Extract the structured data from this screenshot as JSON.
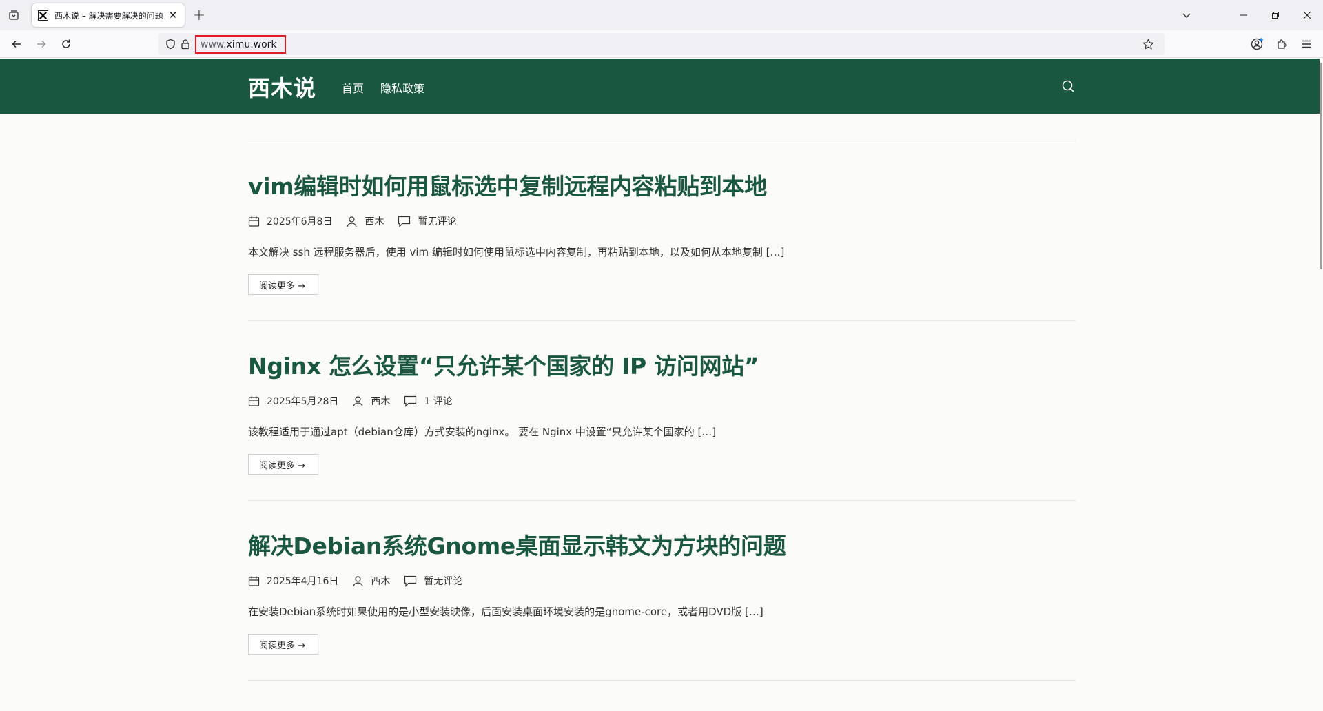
{
  "browser": {
    "tab": {
      "title": "西木说 – 解决需要解决的问题",
      "close_glyph": "✕"
    },
    "new_tab_glyph": "+",
    "url": {
      "prefix": "www.",
      "host": "ximu.work"
    }
  },
  "site": {
    "logo": "西木说",
    "nav": [
      "首页",
      "隐私政策"
    ],
    "brand_color": "#1a5741"
  },
  "posts": [
    {
      "title": "vim编辑时如何用鼠标选中复制远程内容粘贴到本地",
      "date": "2025年6月8日",
      "author": "西木",
      "comments": "暂无评论",
      "excerpt": "本文解决 ssh 远程服务器后，使用 vim 编辑时如何使用鼠标选中内容复制，再粘贴到本地，以及如何从本地复制 […]",
      "read_more": "阅读更多 →"
    },
    {
      "title": "Nginx 怎么设置“只允许某个国家的 IP 访问网站”",
      "date": "2025年5月28日",
      "author": "西木",
      "comments": "1 评论",
      "excerpt": "该教程适用于通过apt（debian仓库）方式安装的nginx。 要在 Nginx 中设置“只允许某个国家的 […]",
      "read_more": "阅读更多 →"
    },
    {
      "title": "解决Debian系统Gnome桌面显示韩文为方块的问题",
      "date": "2025年4月16日",
      "author": "西木",
      "comments": "暂无评论",
      "excerpt": "在安装Debian系统时如果使用的是小型安装映像，后面安装桌面环境安装的是gnome-core，或者用DVD版 […]",
      "read_more": "阅读更多 →"
    }
  ]
}
